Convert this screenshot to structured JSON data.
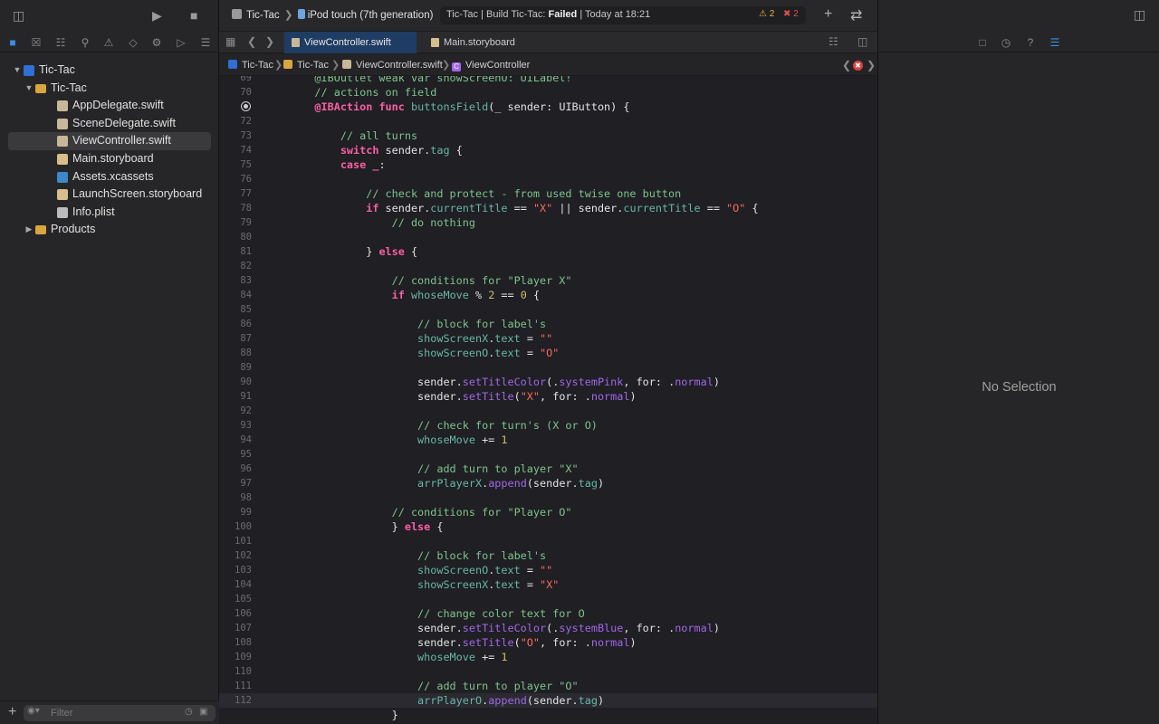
{
  "navigator": {
    "tree": [
      {
        "label": "Tic-Tac",
        "icon": "project-icon",
        "depth": 0,
        "expanded": true
      },
      {
        "label": "Tic-Tac",
        "icon": "folder-icon",
        "depth": 1,
        "expanded": true
      },
      {
        "label": "AppDelegate.swift",
        "icon": "swift-file-icon",
        "depth": 2
      },
      {
        "label": "SceneDelegate.swift",
        "icon": "swift-file-icon",
        "depth": 2
      },
      {
        "label": "ViewController.swift",
        "icon": "swift-file-icon",
        "depth": 2,
        "selected": true
      },
      {
        "label": "Main.storyboard",
        "icon": "storyboard-icon",
        "depth": 2
      },
      {
        "label": "Assets.xcassets",
        "icon": "assets-icon",
        "depth": 2
      },
      {
        "label": "LaunchScreen.storyboard",
        "icon": "storyboard-icon",
        "depth": 2
      },
      {
        "label": "Info.plist",
        "icon": "plist-icon",
        "depth": 2
      },
      {
        "label": "Products",
        "icon": "folder-icon",
        "depth": 1,
        "expanded": false
      }
    ],
    "filter_placeholder": "Filter"
  },
  "toolbar": {
    "scheme": "Tic-Tac",
    "destination": "iPod touch (7th generation)",
    "activity_prefix": "Tic-Tac | Build Tic-Tac: ",
    "activity_status": "Failed",
    "activity_time": " | Today at 18:21",
    "warning_count": "2",
    "error_count": "2"
  },
  "tabs": [
    {
      "label": "ViewController.swift",
      "active": true
    },
    {
      "label": "Main.storyboard",
      "active": false
    }
  ],
  "jump_bar": {
    "crumbs": [
      "Tic-Tac",
      "Tic-Tac",
      "ViewController.swift",
      "ViewController"
    ]
  },
  "code": {
    "lines": [
      {
        "n": "69",
        "src": [
          [
            "    @IBOutlet weak var showScreenO: UILabel!",
            "cm"
          ]
        ]
      },
      {
        "n": "70",
        "src": [
          [
            "    // actions on field",
            "cm"
          ]
        ]
      },
      {
        "n": "",
        "src": [
          [
            "    ",
            "plain"
          ],
          [
            "@IBAction",
            "attr"
          ],
          [
            " ",
            "plain"
          ],
          [
            "func",
            "kw"
          ],
          [
            " ",
            "plain"
          ],
          [
            "buttonsField",
            "fn"
          ],
          [
            "(_ sender: UIButton) {",
            "plain"
          ]
        ],
        "bp": true
      },
      {
        "n": "72",
        "src": []
      },
      {
        "n": "73",
        "src": [
          [
            "        // all turns",
            "cm"
          ]
        ]
      },
      {
        "n": "74",
        "src": [
          [
            "        ",
            "plain"
          ],
          [
            "switch",
            "kw"
          ],
          [
            " sender.",
            "plain"
          ],
          [
            "tag",
            "prop"
          ],
          [
            " {",
            "plain"
          ]
        ]
      },
      {
        "n": "75",
        "src": [
          [
            "        ",
            "plain"
          ],
          [
            "case",
            "kw"
          ],
          [
            " ",
            "plain"
          ],
          [
            "_",
            "kw"
          ],
          [
            ":",
            "plain"
          ]
        ]
      },
      {
        "n": "76",
        "src": []
      },
      {
        "n": "77",
        "src": [
          [
            "            // check and protect - from used twise one button",
            "cm"
          ]
        ]
      },
      {
        "n": "78",
        "src": [
          [
            "            ",
            "plain"
          ],
          [
            "if",
            "kw"
          ],
          [
            " sender.",
            "plain"
          ],
          [
            "currentTitle",
            "prop"
          ],
          [
            " == ",
            "plain"
          ],
          [
            "\"X\"",
            "str"
          ],
          [
            " || sender.",
            "plain"
          ],
          [
            "currentTitle",
            "prop"
          ],
          [
            " == ",
            "plain"
          ],
          [
            "\"O\"",
            "str"
          ],
          [
            " {",
            "plain"
          ]
        ]
      },
      {
        "n": "79",
        "src": [
          [
            "                // do nothing",
            "cm"
          ]
        ]
      },
      {
        "n": "80",
        "src": []
      },
      {
        "n": "81",
        "src": [
          [
            "            } ",
            "plain"
          ],
          [
            "else",
            "kw"
          ],
          [
            " {",
            "plain"
          ]
        ]
      },
      {
        "n": "82",
        "src": []
      },
      {
        "n": "83",
        "src": [
          [
            "                // conditions for \"Player X\"",
            "cm"
          ]
        ]
      },
      {
        "n": "84",
        "src": [
          [
            "                ",
            "plain"
          ],
          [
            "if",
            "kw"
          ],
          [
            " ",
            "plain"
          ],
          [
            "whoseMove",
            "prop"
          ],
          [
            " % ",
            "plain"
          ],
          [
            "2",
            "num"
          ],
          [
            " == ",
            "plain"
          ],
          [
            "0",
            "num"
          ],
          [
            " {",
            "plain"
          ]
        ]
      },
      {
        "n": "85",
        "src": []
      },
      {
        "n": "86",
        "src": [
          [
            "                    // block for label's",
            "cm"
          ]
        ]
      },
      {
        "n": "87",
        "src": [
          [
            "                    ",
            "plain"
          ],
          [
            "showScreenX",
            "prop"
          ],
          [
            ".",
            "plain"
          ],
          [
            "text",
            "prop"
          ],
          [
            " = ",
            "plain"
          ],
          [
            "\"\"",
            "str"
          ]
        ]
      },
      {
        "n": "88",
        "src": [
          [
            "                    ",
            "plain"
          ],
          [
            "showScreenO",
            "prop"
          ],
          [
            ".",
            "plain"
          ],
          [
            "text",
            "prop"
          ],
          [
            " = ",
            "plain"
          ],
          [
            "\"O\"",
            "str"
          ]
        ]
      },
      {
        "n": "89",
        "src": []
      },
      {
        "n": "90",
        "src": [
          [
            "                    sender.",
            "plain"
          ],
          [
            "setTitleColor",
            "sysm"
          ],
          [
            "(.",
            "plain"
          ],
          [
            "systemPink",
            "sysm"
          ],
          [
            ", for: .",
            "plain"
          ],
          [
            "normal",
            "sysm"
          ],
          [
            ")",
            "plain"
          ]
        ]
      },
      {
        "n": "91",
        "src": [
          [
            "                    sender.",
            "plain"
          ],
          [
            "setTitle",
            "sysm"
          ],
          [
            "(",
            "plain"
          ],
          [
            "\"X\"",
            "str"
          ],
          [
            ", for: .",
            "plain"
          ],
          [
            "normal",
            "sysm"
          ],
          [
            ")",
            "plain"
          ]
        ]
      },
      {
        "n": "92",
        "src": []
      },
      {
        "n": "93",
        "src": [
          [
            "                    // check for turn's (X or O)",
            "cm"
          ]
        ]
      },
      {
        "n": "94",
        "src": [
          [
            "                    ",
            "plain"
          ],
          [
            "whoseMove",
            "prop"
          ],
          [
            " += ",
            "plain"
          ],
          [
            "1",
            "num"
          ]
        ]
      },
      {
        "n": "95",
        "src": []
      },
      {
        "n": "96",
        "src": [
          [
            "                    // add turn to player \"X\"",
            "cm"
          ]
        ]
      },
      {
        "n": "97",
        "src": [
          [
            "                    ",
            "plain"
          ],
          [
            "arrPlayerX",
            "prop"
          ],
          [
            ".",
            "plain"
          ],
          [
            "append",
            "sysm"
          ],
          [
            "(sender.",
            "plain"
          ],
          [
            "tag",
            "prop"
          ],
          [
            ")",
            "plain"
          ]
        ]
      },
      {
        "n": "98",
        "src": []
      },
      {
        "n": "99",
        "src": [
          [
            "                // conditions for \"Player O\"",
            "cm"
          ]
        ]
      },
      {
        "n": "100",
        "src": [
          [
            "                } ",
            "plain"
          ],
          [
            "else",
            "kw"
          ],
          [
            " {",
            "plain"
          ]
        ]
      },
      {
        "n": "101",
        "src": []
      },
      {
        "n": "102",
        "src": [
          [
            "                    // block for label's",
            "cm"
          ]
        ]
      },
      {
        "n": "103",
        "src": [
          [
            "                    ",
            "plain"
          ],
          [
            "showScreenO",
            "prop"
          ],
          [
            ".",
            "plain"
          ],
          [
            "text",
            "prop"
          ],
          [
            " = ",
            "plain"
          ],
          [
            "\"\"",
            "str"
          ]
        ]
      },
      {
        "n": "104",
        "src": [
          [
            "                    ",
            "plain"
          ],
          [
            "showScreenX",
            "prop"
          ],
          [
            ".",
            "plain"
          ],
          [
            "text",
            "prop"
          ],
          [
            " = ",
            "plain"
          ],
          [
            "\"X\"",
            "str"
          ]
        ]
      },
      {
        "n": "105",
        "src": []
      },
      {
        "n": "106",
        "src": [
          [
            "                    // change color text for O",
            "cm"
          ]
        ]
      },
      {
        "n": "107",
        "src": [
          [
            "                    sender.",
            "plain"
          ],
          [
            "setTitleColor",
            "sysm"
          ],
          [
            "(.",
            "plain"
          ],
          [
            "systemBlue",
            "sysm"
          ],
          [
            ", for: .",
            "plain"
          ],
          [
            "normal",
            "sysm"
          ],
          [
            ")",
            "plain"
          ]
        ]
      },
      {
        "n": "108",
        "src": [
          [
            "                    sender.",
            "plain"
          ],
          [
            "setTitle",
            "sysm"
          ],
          [
            "(",
            "plain"
          ],
          [
            "\"O\"",
            "str"
          ],
          [
            ", for: .",
            "plain"
          ],
          [
            "normal",
            "sysm"
          ],
          [
            ")",
            "plain"
          ]
        ]
      },
      {
        "n": "109",
        "src": [
          [
            "                    ",
            "plain"
          ],
          [
            "whoseMove",
            "prop"
          ],
          [
            " += ",
            "plain"
          ],
          [
            "1",
            "num"
          ]
        ]
      },
      {
        "n": "110",
        "src": []
      },
      {
        "n": "111",
        "src": [
          [
            "                    // add turn to player \"O\"",
            "cm"
          ]
        ]
      },
      {
        "n": "112",
        "src": [
          [
            "                    ",
            "plain"
          ],
          [
            "arrPlayerO",
            "prop"
          ],
          [
            ".",
            "plain"
          ],
          [
            "append",
            "sysm"
          ],
          [
            "(sender.",
            "plain"
          ],
          [
            "tag",
            "prop"
          ],
          [
            ")",
            "plain"
          ]
        ],
        "highlight": true
      },
      {
        "n": "",
        "src": [
          [
            "                }",
            "plain"
          ]
        ]
      }
    ]
  },
  "inspector": {
    "empty_text": "No Selection"
  },
  "colors": {
    "accent": "#3a8ee6",
    "error": "#e05050",
    "warning": "#e8b43a"
  }
}
